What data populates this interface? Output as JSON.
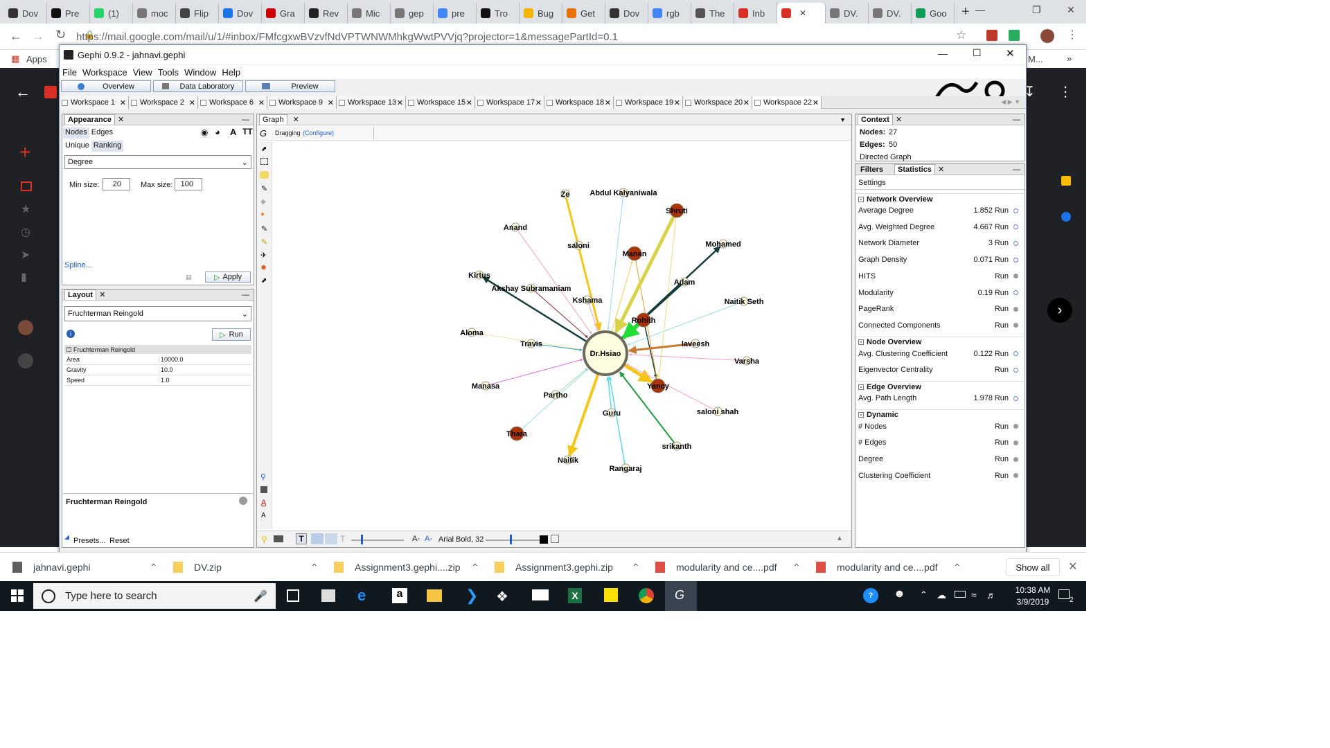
{
  "browser": {
    "tabs": [
      {
        "label": "Dov",
        "color": "#333"
      },
      {
        "label": "Pre",
        "color": "#111"
      },
      {
        "label": "(1)",
        "color": "#25d366"
      },
      {
        "label": "moc",
        "color": "#777"
      },
      {
        "label": "Flip",
        "color": "#444"
      },
      {
        "label": "Dov",
        "color": "#1a73e8"
      },
      {
        "label": "Gra",
        "color": "#c00"
      },
      {
        "label": "Rev",
        "color": "#222"
      },
      {
        "label": "Mic",
        "color": "#777"
      },
      {
        "label": "gep",
        "color": "#777"
      },
      {
        "label": "pre",
        "color": "#4285f4"
      },
      {
        "label": "Tro",
        "color": "#111"
      },
      {
        "label": "Bug",
        "color": "#f4b400"
      },
      {
        "label": "Get",
        "color": "#e8710a"
      },
      {
        "label": "Dov",
        "color": "#333"
      },
      {
        "label": "rgb",
        "color": "#4285f4"
      },
      {
        "label": "The",
        "color": "#555"
      },
      {
        "label": "Inb",
        "color": "#d93025"
      },
      {
        "label": "",
        "color": "#d93025",
        "active": true
      },
      {
        "label": "DV.",
        "color": "#777"
      },
      {
        "label": "DV.",
        "color": "#777"
      },
      {
        "label": "Goo",
        "color": "#0f9d58"
      }
    ],
    "url": "https://mail.google.com/mail/u/1/#inbox/FMfcgxwBVzvfNdVPTWNWMhkgWwtPVVjq?projector=1&messagePartId=0.1",
    "bookmarks_label": "Apps",
    "bookmark_right": "M..."
  },
  "gephi": {
    "title": "Gephi 0.9.2 - jahnavi.gephi",
    "menu": [
      "File",
      "Workspace",
      "View",
      "Tools",
      "Window",
      "Help"
    ],
    "mode_buttons": [
      "Overview",
      "Data Laboratory",
      "Preview"
    ],
    "workspaces": [
      "Workspace 1",
      "Workspace 2",
      "Workspace 6",
      "Workspace 9",
      "Workspace 13",
      "Workspace 15",
      "Workspace 17",
      "Workspace 18",
      "Workspace 19",
      "Workspace 20",
      "Workspace 22"
    ],
    "appearance": {
      "title": "Appearance",
      "tabs": [
        "Nodes",
        "Edges"
      ],
      "subtabs": [
        "Unique",
        "Ranking"
      ],
      "attribute": "Degree",
      "min_label": "Min size:",
      "min_value": "20",
      "max_label": "Max size:",
      "max_value": "100",
      "spline": "Spline...",
      "apply": "Apply"
    },
    "layout": {
      "title": "Layout",
      "algorithm": "Fruchterman Reingold",
      "run": "Run",
      "section": "Fruchterman Reingold",
      "props": [
        {
          "name": "Area",
          "value": "10000.0"
        },
        {
          "name": "Gravity",
          "value": "10.0"
        },
        {
          "name": "Speed",
          "value": "1.0"
        }
      ],
      "footer_title": "Fruchterman Reingold",
      "presets": "Presets...",
      "reset": "Reset"
    },
    "graph": {
      "tab": "Graph",
      "mode": "Dragging",
      "configure": "(Configure)",
      "font": "Arial Bold, 32"
    },
    "context": {
      "title": "Context",
      "nodes_label": "Nodes:",
      "nodes": "27",
      "edges_label": "Edges:",
      "edges": "50",
      "type": "Directed Graph"
    },
    "statistics": {
      "tabs": [
        "Filters",
        "Statistics"
      ],
      "settings": "Settings",
      "run_label": "Run",
      "sections": [
        {
          "title": "Network Overview",
          "rows": [
            {
              "name": "Average Degree",
              "value": "1.852",
              "help": true
            },
            {
              "name": "Avg. Weighted Degree",
              "value": "4.667",
              "help": true
            },
            {
              "name": "Network Diameter",
              "value": "3",
              "help": true
            },
            {
              "name": "Graph Density",
              "value": "0.071",
              "help": true
            },
            {
              "name": "HITS",
              "value": "",
              "help": false
            },
            {
              "name": "Modularity",
              "value": "0.19",
              "help": true
            },
            {
              "name": "PageRank",
              "value": "",
              "help": false
            },
            {
              "name": "Connected Components",
              "value": "",
              "help": false
            }
          ]
        },
        {
          "title": "Node Overview",
          "rows": [
            {
              "name": "Avg. Clustering Coefficient",
              "value": "0.122",
              "help": true
            },
            {
              "name": "Eigenvector Centrality",
              "value": "",
              "help": true
            }
          ]
        },
        {
          "title": "Edge Overview",
          "rows": [
            {
              "name": "Avg. Path Length",
              "value": "1.978",
              "help": true
            }
          ]
        },
        {
          "title": "Dynamic",
          "rows": [
            {
              "name": "# Nodes",
              "value": "",
              "help": false
            },
            {
              "name": "# Edges",
              "value": "",
              "help": false
            },
            {
              "name": "Degree",
              "value": "",
              "help": false
            },
            {
              "name": "Clustering Coefficient",
              "value": "",
              "help": false
            }
          ]
        }
      ]
    }
  },
  "network": {
    "center": "Dr.Hsiao",
    "nodes": [
      {
        "label": "Ze",
        "color": "#fffbe0"
      },
      {
        "label": "Abdul Kalyaniwala",
        "color": "#fffbe0"
      },
      {
        "label": "Shruti",
        "color": "#a83408"
      },
      {
        "label": "Anand",
        "color": "#fffbe0"
      },
      {
        "label": "saloni",
        "color": "#fffbe0"
      },
      {
        "label": "Manan",
        "color": "#a83408"
      },
      {
        "label": "Mohamed",
        "color": "#fffbe0"
      },
      {
        "label": "Kirtus",
        "color": "#fffbe0"
      },
      {
        "label": "Akshay Subramaniam",
        "color": "#fffbe0"
      },
      {
        "label": "Adam",
        "color": "#fffbe0"
      },
      {
        "label": "Kshama",
        "color": "#fffbe0"
      },
      {
        "label": "Naitik Seth",
        "color": "#fffbe0"
      },
      {
        "label": "Rohith",
        "color": "#a83408"
      },
      {
        "label": "Aloma",
        "color": "#fffbe0"
      },
      {
        "label": "Travis",
        "color": "#fffbe0"
      },
      {
        "label": "laveesh",
        "color": "#fffbe0"
      },
      {
        "label": "Varsha",
        "color": "#fffbe0"
      },
      {
        "label": "Manasa",
        "color": "#fffbe0"
      },
      {
        "label": "Yancy",
        "color": "#a83408"
      },
      {
        "label": "Partho",
        "color": "#fffbe0"
      },
      {
        "label": "saloni shah",
        "color": "#fffbe0"
      },
      {
        "label": "Guru",
        "color": "#fffbe0"
      },
      {
        "label": "Thara",
        "color": "#a83408"
      },
      {
        "label": "srikanth",
        "color": "#fffbe0"
      },
      {
        "label": "Naitik",
        "color": "#fffbe0"
      },
      {
        "label": "Rangaraj",
        "color": "#fffbe0"
      }
    ]
  },
  "downloads": {
    "items": [
      "jahnavi.gephi",
      "DV.zip",
      "Assignment3.gephi....zip",
      "Assignment3.gephi.zip",
      "modularity and ce....pdf",
      "modularity and ce....pdf"
    ],
    "show_all": "Show all"
  },
  "taskbar": {
    "search_placeholder": "Type here to search",
    "time": "10:38 AM",
    "date": "3/9/2019",
    "notif": "2"
  }
}
